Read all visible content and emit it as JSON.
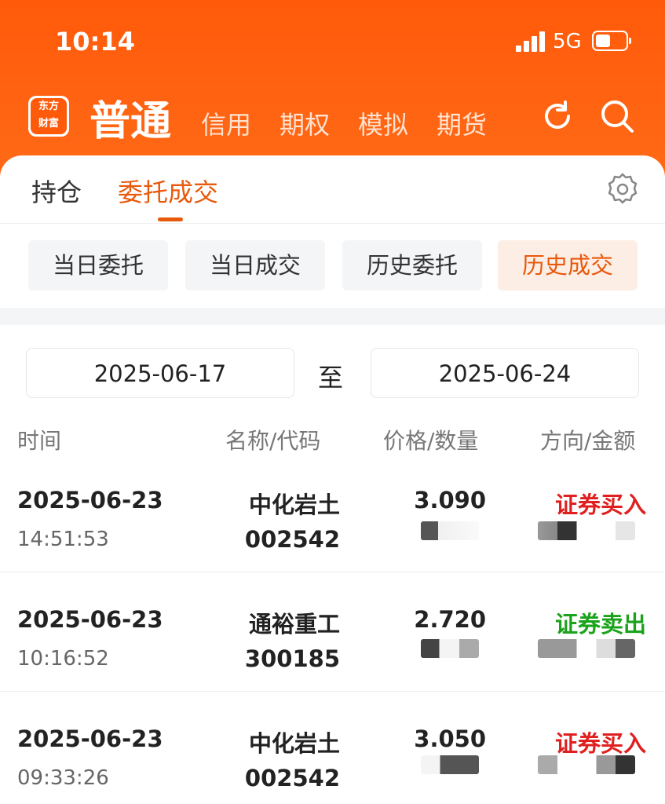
{
  "status_bar": {
    "time": "10:14",
    "network": "5G"
  },
  "header": {
    "logo_line1": "东方",
    "logo_line2": "财富",
    "account_active": "普通",
    "account_tabs": [
      "信用",
      "期权",
      "模拟",
      "期货"
    ]
  },
  "main_tabs": {
    "positions": "持仓",
    "orders": "委托成交"
  },
  "sub_tabs": [
    "当日委托",
    "当日成交",
    "历史委托",
    "历史成交"
  ],
  "date_range": {
    "start": "2025-06-17",
    "separator": "至",
    "end": "2025-06-24"
  },
  "columns": {
    "time": "时间",
    "name_code": "名称/代码",
    "price_qty": "价格/数量",
    "dir_amount": "方向/金额"
  },
  "rows": [
    {
      "date": "2025-06-23",
      "time": "14:51:53",
      "name": "中化岩土",
      "code": "002542",
      "price": "3.090",
      "direction": "证券买入"
    },
    {
      "date": "2025-06-23",
      "time": "10:16:52",
      "name": "通裕重工",
      "code": "300185",
      "price": "2.720",
      "direction": "证券卖出"
    },
    {
      "date": "2025-06-23",
      "time": "09:33:26",
      "name": "中化岩土",
      "code": "002542",
      "price": "3.050",
      "direction": "证券买入"
    }
  ],
  "colors": {
    "brand": "#ff5a0a",
    "accent": "#e8590c",
    "buy": "#e02020",
    "sell": "#1aa31a"
  }
}
